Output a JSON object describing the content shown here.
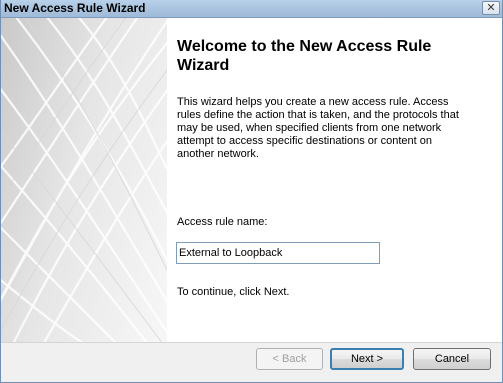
{
  "window": {
    "title": "New Access Rule Wizard",
    "close_glyph": "✕"
  },
  "main": {
    "heading": "Welcome to the New Access Rule Wizard",
    "description": "This wizard helps you create a new access rule. Access rules define the action that is taken, and the protocols that may be used, when specified clients from one network attempt to access specific destinations or content on another network.",
    "rule_name_label": "Access rule name:",
    "rule_name_value": "External to Loopback",
    "continue_text": "To continue, click Next."
  },
  "buttons": {
    "back": "< Back",
    "next": "Next >",
    "cancel": "Cancel"
  }
}
